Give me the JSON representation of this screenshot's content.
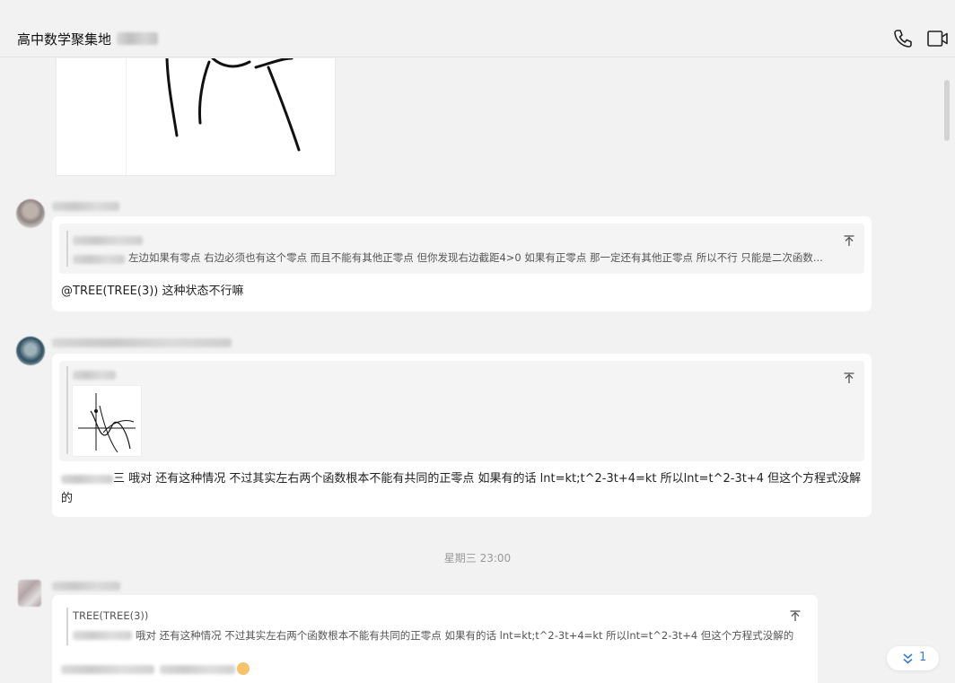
{
  "header": {
    "title": "高中数学聚集地",
    "phone_icon": "phone-icon",
    "video_icon": "video-icon"
  },
  "messages": [
    {
      "quote_text": "左边如果有零点 右边必须也有这个零点 而且不能有其他正零点 但你发现右边截距4>0 如果有正零点 那一定还有其他正零点 所以不行 只能是二次函数...",
      "text": "@TREE(TREE(3)) 这种状态不行嘛"
    },
    {
      "text_mark": "三",
      "text": "哦对 还有这种情况 不过其实左右两个函数根本不能有共同的正零点 如果有的话 lnt=kt;t^2-3t+4=kt 所以lnt=t^2-3t+4 但这个方程式没解的"
    },
    {
      "quote_name": "TREE(TREE(3))",
      "quote_text": "哦对 还有这种情况 不过其实左右两个函数根本不能有共同的正零点 如果有的话 lnt=kt;t^2-3t+4=kt 所以lnt=t^2-3t+4 但这个方程式没解的"
    }
  ],
  "time_separator": "星期三 23:00",
  "new_messages": {
    "count": "1",
    "icon": "chevrons-down-icon"
  },
  "colors": {
    "background": "#f2f2f2",
    "bubble": "#ffffff",
    "accent": "#3a7bd5"
  }
}
